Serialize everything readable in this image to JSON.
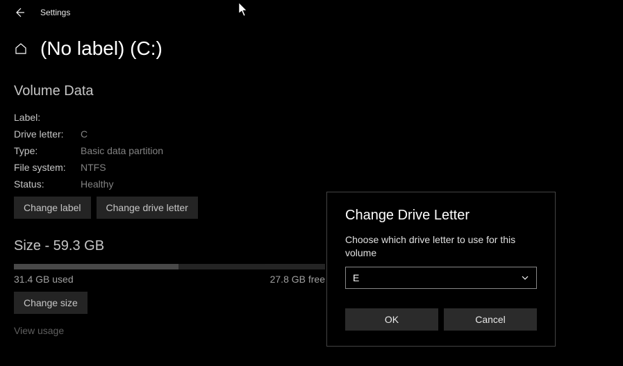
{
  "titlebar": {
    "title": "Settings"
  },
  "page": {
    "title": "(No label) (C:)"
  },
  "volume": {
    "section_label": "Volume Data",
    "rows": {
      "label_l": "Label:",
      "label_v": "",
      "letter_l": "Drive letter:",
      "letter_v": "C",
      "type_l": "Type:",
      "type_v": "Basic data partition",
      "fs_l": "File system:",
      "fs_v": "NTFS",
      "status_l": "Status:",
      "status_v": "Healthy"
    },
    "btn_change_label": "Change label",
    "btn_change_letter": "Change drive letter"
  },
  "size": {
    "header": "Size - 59.3 GB",
    "used": "31.4 GB used",
    "free": "27.8 GB free",
    "btn_change_size": "Change size",
    "view_usage": "View usage"
  },
  "dialog": {
    "title": "Change Drive Letter",
    "text": "Choose which drive letter to use for this volume",
    "selected": "E",
    "ok": "OK",
    "cancel": "Cancel"
  }
}
